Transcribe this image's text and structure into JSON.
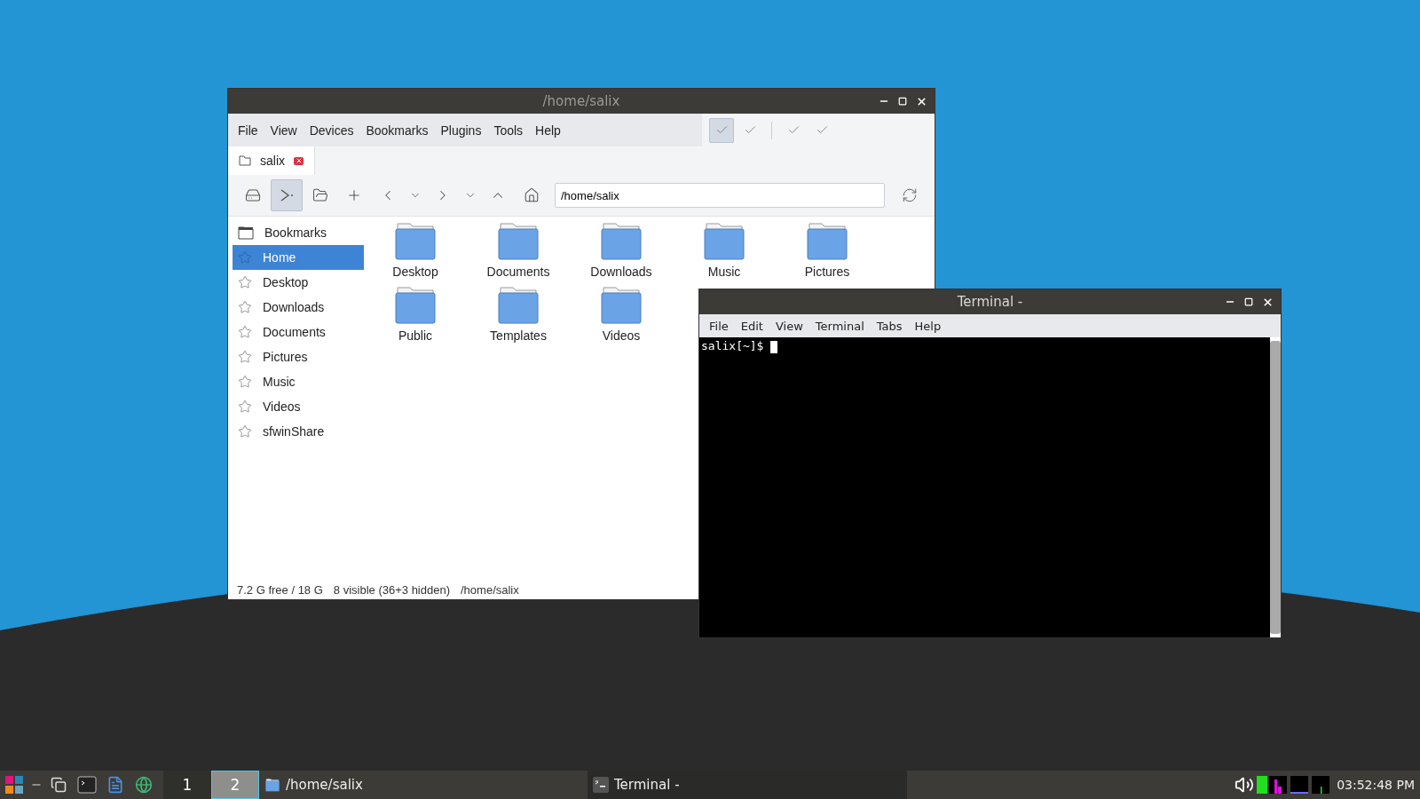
{
  "file_manager": {
    "title": "/home/salix",
    "menu": [
      "File",
      "View",
      "Devices",
      "Bookmarks",
      "Plugins",
      "Tools",
      "Help"
    ],
    "view_toggles": [
      {
        "selected": true
      },
      {
        "selected": false
      },
      {
        "selected": false
      },
      {
        "selected": false
      }
    ],
    "tabs": [
      {
        "label": "salix",
        "selected": true
      }
    ],
    "toolbar": [
      {
        "kind": "drive",
        "pressed": false
      },
      {
        "kind": "terminal",
        "pressed": true
      },
      {
        "kind": "folder",
        "pressed": false
      },
      {
        "kind": "new",
        "pressed": false
      },
      {
        "kind": "back",
        "pressed": false
      },
      {
        "kind": "back-history",
        "pressed": false
      },
      {
        "kind": "forward",
        "pressed": false
      },
      {
        "kind": "forward-history",
        "pressed": false
      },
      {
        "kind": "up",
        "pressed": false
      },
      {
        "kind": "home",
        "pressed": false
      }
    ],
    "location": "/home/salix",
    "sidebar": [
      {
        "label": "Bookmarks",
        "kind": "header",
        "selected": false
      },
      {
        "label": "Home",
        "kind": "bookmark",
        "selected": true
      },
      {
        "label": "Desktop",
        "kind": "bookmark",
        "selected": false
      },
      {
        "label": "Downloads",
        "kind": "bookmark",
        "selected": false
      },
      {
        "label": "Documents",
        "kind": "bookmark",
        "selected": false
      },
      {
        "label": "Pictures",
        "kind": "bookmark",
        "selected": false
      },
      {
        "label": "Music",
        "kind": "bookmark",
        "selected": false
      },
      {
        "label": "Videos",
        "kind": "bookmark",
        "selected": false
      },
      {
        "label": "sfwinShare",
        "kind": "bookmark",
        "selected": false
      }
    ],
    "files": [
      "Desktop",
      "Documents",
      "Downloads",
      "Music",
      "Pictures",
      "Public",
      "Templates",
      "Videos"
    ],
    "status": [
      "7.2 G free / 18 G",
      "8 visible (36+3 hidden)",
      "/home/salix"
    ]
  },
  "terminal": {
    "title": "Terminal -",
    "menu": [
      "File",
      "Edit",
      "View",
      "Terminal",
      "Tabs",
      "Help"
    ],
    "prompt": "salix[~]$"
  },
  "taskbar": {
    "workspaces": [
      {
        "label": "1",
        "selected": false
      },
      {
        "label": "2",
        "selected": true
      }
    ],
    "tasks": [
      {
        "label": "/home/salix",
        "kind": "folder",
        "selected": false
      },
      {
        "label": "Terminal -",
        "kind": "terminal",
        "selected": true
      }
    ],
    "clock": "03:52:48 PM"
  }
}
